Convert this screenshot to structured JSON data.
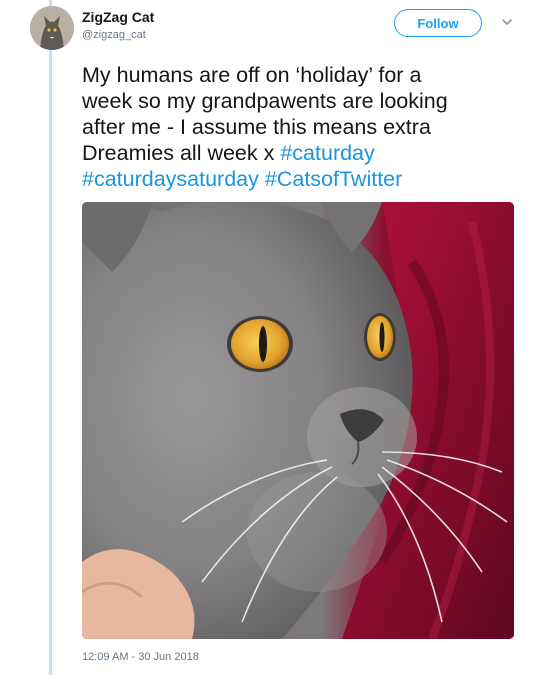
{
  "author": {
    "name": "ZigZag Cat",
    "handle": "@zigzag_cat"
  },
  "follow_label": "Follow",
  "tweet": {
    "text_lines": [
      "My humans are off on ‘holiday’ for a",
      "week so my grandpawents are looking",
      "after me - I assume this means extra"
    ],
    "line4_text": "Dreamies all week x ",
    "hashtags": [
      "#caturday",
      "#caturdaysaturday",
      "#CatsofTwitter"
    ]
  },
  "timestamp": "12:09 AM - 30 Jun 2018",
  "colors": {
    "link_blue": "#1b95e0",
    "follow_blue": "#1da1f2",
    "thread_line": "#bfe3f5",
    "muted_gray": "#657786"
  },
  "icons": {
    "menu": "chevron-down-icon"
  }
}
